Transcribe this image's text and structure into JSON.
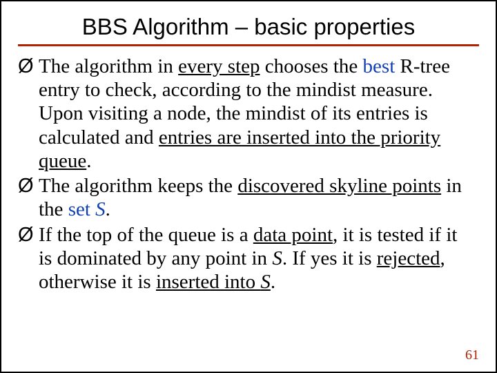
{
  "title": "BBS Algorithm – basic properties",
  "bullets": {
    "sym": "Ø",
    "b1": {
      "t1": "The algorithm in ",
      "u1": "every step",
      "t2": " chooses the ",
      "best": "best",
      "t3": " R-tree entry to check, according to the mindist measure. Upon visiting a node, the mindist of its entries is calculated and ",
      "u2": "entries are inserted into the priority queue",
      "t4": "."
    },
    "b2": {
      "t1": "The algorithm keeps the ",
      "u1": "discovered skyline points",
      "t2": " in the ",
      "set": "set ",
      "S": "S",
      "t3": "."
    },
    "b3": {
      "t1": "If the top of the queue is a ",
      "u1": "data point",
      "t2": ", it is tested if it is dominated by any point in ",
      "S1": "S",
      "t3": ". If yes it is ",
      "u2": "rejected",
      "t4": ", otherwise it is ",
      "u3": "inserted into ",
      "S2": "S",
      "t5": "."
    }
  },
  "page": "61"
}
